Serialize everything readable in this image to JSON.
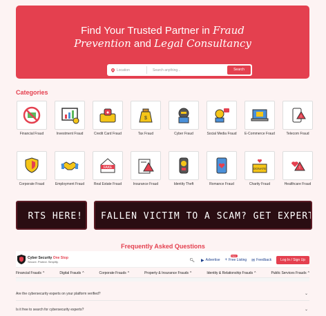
{
  "hero": {
    "title_line1_plain": "Find Your Trusted Partner in ",
    "title_line1_script": "Fraud",
    "title_line2_script_a": "Prevention",
    "title_line2_plain": " and ",
    "title_line2_script_b": "Legal Consultancy",
    "location_placeholder": "Location",
    "search_placeholder": "Search anything...",
    "search_button": "Search"
  },
  "categories": {
    "heading": "Categories",
    "items": [
      {
        "label": "Financial Fraud",
        "icon": "no-money-icon"
      },
      {
        "label": "Investment Fraud",
        "icon": "investment-chart-icon"
      },
      {
        "label": "Credit Card Fraud",
        "icon": "credit-card-lock-icon"
      },
      {
        "label": "Tax Fraud",
        "icon": "money-bag-icon"
      },
      {
        "label": "Cyber Fraud",
        "icon": "hacker-icon"
      },
      {
        "label": "Social Media Fraud",
        "icon": "social-media-user-icon"
      },
      {
        "label": "E-Commerce Fraud",
        "icon": "laptop-store-icon"
      },
      {
        "label": "Telecom Fraud",
        "icon": "phone-alert-icon"
      },
      {
        "label": "Corporate Fraud",
        "icon": "corporate-shield-icon"
      },
      {
        "label": "Employment Fraud",
        "icon": "handshake-icon"
      },
      {
        "label": "Real Estate Fraud",
        "icon": "fake-house-icon"
      },
      {
        "label": "Insurance Fraud",
        "icon": "insurance-alert-icon"
      },
      {
        "label": "Identity Theft",
        "icon": "identity-mask-icon"
      },
      {
        "label": "Romance Fraud",
        "icon": "romance-phone-icon"
      },
      {
        "label": "Charity Fraud",
        "icon": "donate-box-icon"
      },
      {
        "label": "Healthcare Fraud",
        "icon": "healthcare-alert-icon"
      }
    ]
  },
  "banners": {
    "left": "RTS HERE!",
    "right": "FALLEN VICTIM TO A SCAM? GET EXPERT HELP"
  },
  "faq": {
    "heading": "Frequently Asked Questions",
    "questions": [
      "Are the cybersecurity experts on your platform verified?",
      "Is it free to search for cybersecurity experts?"
    ]
  },
  "navbar": {
    "brand_main": "Cyber Security",
    "brand_accent": "One Stop",
    "tagline": "Secure. Protect. Simplify.",
    "advertise": "Advertise",
    "free_listing": "Free Listing",
    "free_badge": "New",
    "feedback": "Feedback",
    "login": "Log In / Sign Up"
  },
  "menu": [
    "Financial Frauds",
    "Digital Frauds",
    "Corporate Frauds",
    "Property & Insurance Frauds",
    "Identity & Relationship Frauds",
    "Public Services Frauds"
  ],
  "colors": {
    "accent": "#e4404f",
    "banner_bg": "#2a0d12",
    "link": "#1a3e8c"
  }
}
